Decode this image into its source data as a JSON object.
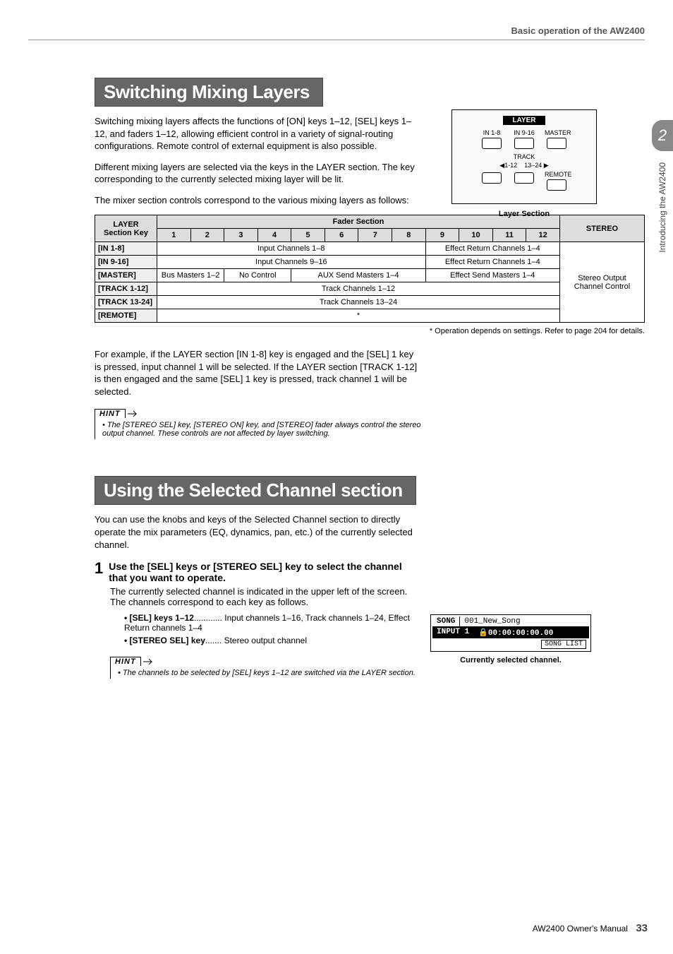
{
  "header": {
    "breadcrumb": "Basic operation of the AW2400"
  },
  "side": {
    "chapter": "2",
    "label": "Introducing the AW2400"
  },
  "section1": {
    "title": "Switching Mixing Layers",
    "p1": "Switching mixing layers affects the functions of [ON] keys 1–12, [SEL] keys 1–12, and faders 1–12, allowing efficient control in a variety of signal-routing configurations. Remote control of external equipment is also possible.",
    "p2": "Different mixing layers are selected via the keys in the LAYER section. The key corresponding to the currently selected mixing layer will be lit.",
    "p3": "The mixer section controls correspond to the various mixing layers as follows:"
  },
  "layer_fig": {
    "title": "LAYER",
    "btn1": "IN 1-8",
    "btn2": "IN 9-16",
    "btn3": "MASTER",
    "track_lbl": "TRACK",
    "track_left": "◀1-12",
    "track_right": "13–24 ▶",
    "remote": "REMOTE",
    "caption": "Layer Section"
  },
  "table": {
    "head_layer": "LAYER Section Key",
    "head_fader": "Fader Section",
    "head_stereo": "STEREO",
    "cols": [
      "1",
      "2",
      "3",
      "4",
      "5",
      "6",
      "7",
      "8",
      "9",
      "10",
      "11",
      "12"
    ],
    "rows": [
      {
        "key": "[IN 1-8]",
        "main": "Input Channels 1–8",
        "side": "Effect Return Channels 1–4"
      },
      {
        "key": "[IN 9-16]",
        "main": "Input Channels 9–16",
        "side": "Effect Return Channels 1–4"
      }
    ],
    "master_row": {
      "key": "[MASTER]",
      "c12": "Bus Masters 1–2",
      "c34": "No Control",
      "c58": "AUX Send Masters 1–4",
      "c912": "Effect Send Masters 1–4"
    },
    "track1": {
      "key": "[TRACK 1-12]",
      "text": "Track Channels 1–12"
    },
    "track2": {
      "key": "[TRACK 13-24]",
      "text": "Track Channels 13–24"
    },
    "remote": {
      "key": "[REMOTE]",
      "text": "*"
    },
    "stereo_text": "Stereo Output Channel Control",
    "footnote": "* Operation depends on settings. Refer to page 204 for details."
  },
  "post_table": {
    "text": "For example, if the LAYER section [IN 1-8] key is engaged and the [SEL] 1 key is pressed, input channel 1 will be selected. If the LAYER section [TRACK 1-12] is then engaged and the same [SEL] 1 key is pressed, track channel 1 will be selected."
  },
  "hint1": {
    "label": "HINT",
    "text": "• The [STEREO SEL] key, [STEREO ON] key, and [STEREO] fader always control the stereo output channel. These controls are not affected by layer switching."
  },
  "section2": {
    "title": "Using the Selected Channel section",
    "intro": "You can use the knobs and keys of the Selected Channel section to directly operate the mix parameters (EQ, dynamics, pan, etc.) of the currently selected channel.",
    "step1_num": "1",
    "step1_head": "Use the [SEL] keys or [STEREO SEL] key to select the channel that you want to operate.",
    "step1_body": "The currently selected channel is indicated in the upper left of the screen. The channels correspond to each key as follows.",
    "bullet1_term": "• [SEL] keys 1–12",
    "bullet1_desc": "............ Input channels 1–16, Track channels 1–24, Effect Return channels 1–4",
    "bullet2_term": "• [STEREO SEL] key",
    "bullet2_desc": "....... Stereo output channel"
  },
  "hint2": {
    "label": "HINT",
    "text": "• The channels to be selected by [SEL] keys 1–12 are switched via the LAYER section."
  },
  "lcd": {
    "song_lbl": "SONG",
    "song_val": "001_New_Song",
    "input_lbl": "INPUT 1",
    "time": "🔒00:00:00:00.00",
    "songlist": "SONG LIST",
    "caption": "Currently selected channel."
  },
  "footer": {
    "manual": "AW2400  Owner's Manual",
    "page": "33"
  }
}
